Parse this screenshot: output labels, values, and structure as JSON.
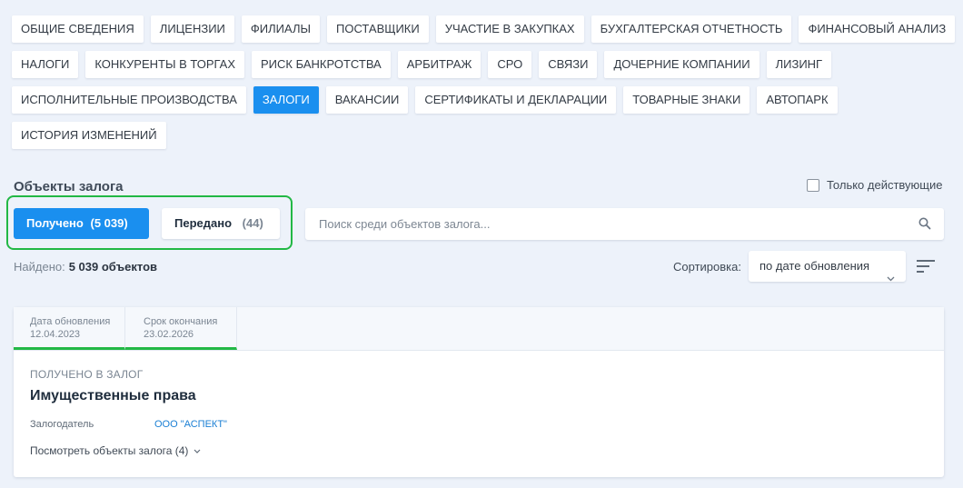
{
  "tabs": {
    "row1": [
      "ОБЩИЕ СВЕДЕНИЯ",
      "ЛИЦЕНЗИИ",
      "ФИЛИАЛЫ",
      "ПОСТАВЩИКИ",
      "УЧАСТИЕ В ЗАКУПКАХ",
      "БУХГАЛТЕРСКАЯ ОТЧЕТНОСТЬ",
      "ФИНАНСОВЫЙ АНАЛИЗ"
    ],
    "row2": [
      "НАЛОГИ",
      "КОНКУРЕНТЫ В ТОРГАХ",
      "РИСК БАНКРОТСТВА",
      "АРБИТРАЖ",
      "СРО",
      "СВЯЗИ",
      "ДОЧЕРНИЕ КОМПАНИИ",
      "ЛИЗИНГ"
    ],
    "row3": [
      "ИСПОЛНИТЕЛЬНЫЕ ПРОИЗВОДСТВА",
      "ЗАЛОГИ",
      "ВАКАНСИИ",
      "СЕРТИФИКАТЫ И ДЕКЛАРАЦИИ",
      "ТОВАРНЫЕ ЗНАКИ",
      "АВТОПАРК"
    ],
    "row4": [
      "ИСТОРИЯ ИЗМЕНЕНИЙ"
    ],
    "active": "ЗАЛОГИ"
  },
  "section": {
    "title": "Объекты залога",
    "only_active_label": "Только действующие"
  },
  "filters": {
    "received_label": "Получено",
    "received_count": "(5 039)",
    "sent_label": "Передано",
    "sent_count": "(44)"
  },
  "search": {
    "placeholder": "Поиск среди объектов залога..."
  },
  "results": {
    "found_label": "Найдено:",
    "found_value": "5 039 объектов"
  },
  "sort": {
    "label": "Сортировка:",
    "value": "по дате обновления"
  },
  "card": {
    "updated_label": "Дата обновления",
    "updated_value": "12.04.2023",
    "expiry_label": "Срок окончания",
    "expiry_value": "23.02.2026",
    "kind": "ПОЛУЧЕНО В ЗАЛОГ",
    "title": "Имущественные права",
    "pledger_label": "Залогодатель",
    "pledger_value": "ООО \"АСПЕКТ\"",
    "view_more": "Посмотреть объекты залога (4)"
  },
  "colors": {
    "accent": "#1a8fef",
    "highlight": "#22b845",
    "link": "#1a7fd4"
  },
  "icons": [
    "search-icon",
    "chevron-down-icon",
    "sort-order-icon"
  ]
}
